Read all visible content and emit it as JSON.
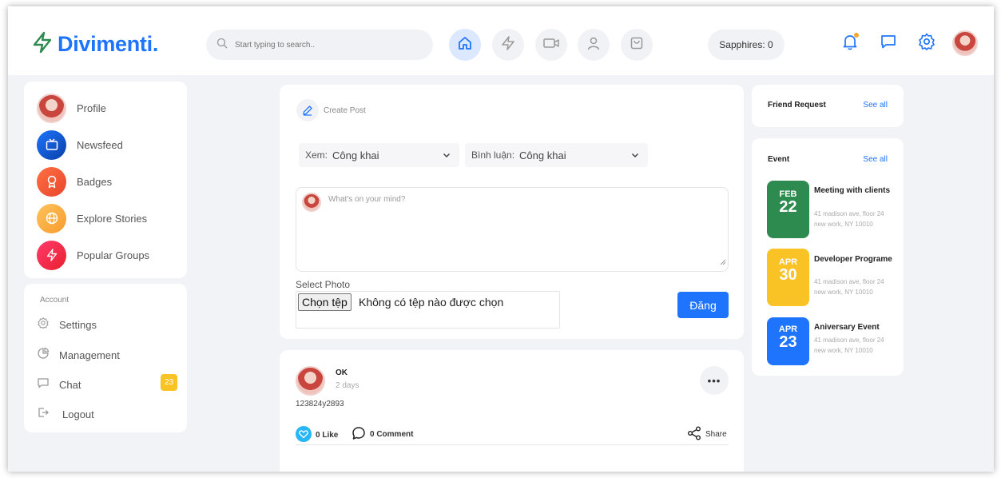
{
  "header": {
    "logo": "Divimenti.",
    "search_placeholder": "Start typing to search..",
    "sapphires": "Sapphires: 0"
  },
  "menu": [
    {
      "label": "Profile"
    },
    {
      "label": "Newsfeed"
    },
    {
      "label": "Badges"
    },
    {
      "label": "Explore Stories"
    },
    {
      "label": "Popular Groups"
    }
  ],
  "account": {
    "title": "Account",
    "settings": "Settings",
    "management": "Management",
    "chat": "Chat",
    "chat_count": "23",
    "logout": "Logout"
  },
  "create_post": {
    "title": "Create Post",
    "view_key": "Xem:",
    "view_value": "Công khai",
    "comment_key": "Bình luận:",
    "comment_value": "Công khai",
    "placeholder": "What's on your mind?",
    "select_photo": "Select Photo",
    "file_button": "Chọn tệp",
    "file_none": "Không có tệp nào được chọn",
    "submit": "Đăng"
  },
  "post": {
    "author": "OK",
    "time": "2 days",
    "content": "123824y2893",
    "likes": "0 Like",
    "comments": "0 Comment",
    "share": "Share"
  },
  "friend_request": {
    "title": "Friend Request",
    "see_all": "See all"
  },
  "events": {
    "title": "Event",
    "see_all": "See all",
    "items": [
      {
        "month": "FEB",
        "day": "22",
        "title": "Meeting with clients",
        "address": "41 madison ave, floor 24 new work, NY 10010",
        "color": "#2e8b4f"
      },
      {
        "month": "APR",
        "day": "30",
        "title": "Developer Programe",
        "address": "41 madison ave, floor 24 new work, NY 10010",
        "color": "#f9c326"
      },
      {
        "month": "APR",
        "day": "23",
        "title": "Aniversary Event",
        "address": "41 madison ave, floor 24 new work, NY 10010",
        "color": "#1e74fd"
      }
    ]
  },
  "colors": {
    "primary": "#1e74fd",
    "background": "#f2f3f7"
  }
}
